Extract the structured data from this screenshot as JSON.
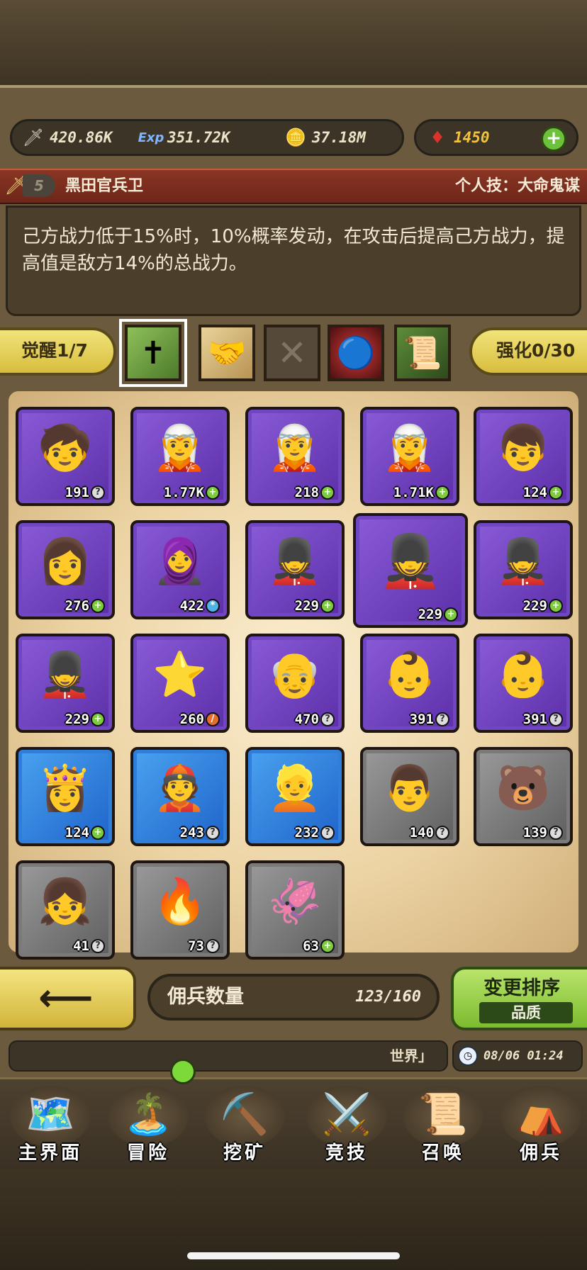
{
  "resources": {
    "attack": {
      "icon": "sword-icon",
      "value": "420.86K"
    },
    "exp": {
      "icon": "exp-icon",
      "value": "351.72K"
    },
    "gold": {
      "icon": "gold-coin-icon",
      "value": "37.18M"
    },
    "gems": {
      "icon": "ruby-icon",
      "value": "1450"
    }
  },
  "skill": {
    "level": "5",
    "name": "黑田官兵卫",
    "type_label": "个人技：大命鬼谋",
    "description": "己方战力低于15%时，10%概率发动，在攻击后提高己方战力，提高值是敌方14%的总战力。"
  },
  "tabs": {
    "awaken_label": "觉醒1/7",
    "enhance_label": "强化0/30",
    "equipment": [
      {
        "icon": "cross-totem-icon",
        "selected": true
      },
      {
        "icon": "handshake-arm-icon",
        "selected": false
      },
      {
        "icon": "empty-slot-x-icon",
        "selected": false
      },
      {
        "icon": "dark-orb-icon",
        "selected": false
      },
      {
        "icon": "scroll-bundle-icon",
        "selected": false
      }
    ]
  },
  "mercenaries": [
    {
      "sprite": "🧒",
      "rarity": "purple",
      "value": "191",
      "badge": "?"
    },
    {
      "sprite": "🧝",
      "rarity": "purple",
      "value": "1.77K",
      "badge": "+"
    },
    {
      "sprite": "🧝",
      "rarity": "purple",
      "value": "218",
      "badge": "+"
    },
    {
      "sprite": "🧝",
      "rarity": "purple",
      "value": "1.71K",
      "badge": "+"
    },
    {
      "sprite": "👦",
      "rarity": "purple",
      "value": "124",
      "badge": "+"
    },
    {
      "sprite": "👩",
      "rarity": "purple",
      "value": "276",
      "badge": "+"
    },
    {
      "sprite": "🧕",
      "rarity": "purple",
      "value": "422",
      "badge": "*"
    },
    {
      "sprite": "💂",
      "rarity": "purple",
      "value": "229",
      "badge": "+"
    },
    {
      "sprite": "💂",
      "rarity": "purple",
      "value": "229",
      "badge": "+",
      "selected": true
    },
    {
      "sprite": "💂",
      "rarity": "purple",
      "value": "229",
      "badge": "+"
    },
    {
      "sprite": "💂",
      "rarity": "purple",
      "value": "229",
      "badge": "+"
    },
    {
      "sprite": "⭐",
      "rarity": "purple",
      "value": "260",
      "badge": "/"
    },
    {
      "sprite": "👴",
      "rarity": "purple",
      "value": "470",
      "badge": "?"
    },
    {
      "sprite": "👶",
      "rarity": "purple",
      "value": "391",
      "badge": "?"
    },
    {
      "sprite": "👶",
      "rarity": "purple",
      "value": "391",
      "badge": "?"
    },
    {
      "sprite": "👸",
      "rarity": "blue",
      "value": "124",
      "badge": "+"
    },
    {
      "sprite": "👲",
      "rarity": "blue",
      "value": "243",
      "badge": "?"
    },
    {
      "sprite": "👱",
      "rarity": "blue",
      "value": "232",
      "badge": "?"
    },
    {
      "sprite": "👨",
      "rarity": "gray",
      "value": "140",
      "badge": "?"
    },
    {
      "sprite": "🐻",
      "rarity": "gray",
      "value": "139",
      "badge": "?"
    },
    {
      "sprite": "👧",
      "rarity": "gray",
      "value": "41",
      "badge": "?"
    },
    {
      "sprite": "🔥",
      "rarity": "gray",
      "value": "73",
      "badge": "?"
    },
    {
      "sprite": "🦑",
      "rarity": "gray",
      "value": "63",
      "badge": "+"
    }
  ],
  "footer": {
    "back_icon": "left-arrow-icon",
    "count_label": "佣兵数量",
    "count_value": "123/160",
    "sort_label": "变更排序",
    "sort_mode": "品质"
  },
  "chat": {
    "text": "世界」",
    "time": "08/06 01:24"
  },
  "nav": [
    {
      "icon": "🗺️",
      "label": "主界面"
    },
    {
      "icon": "🏝️",
      "label": "冒险"
    },
    {
      "icon": "⛏️",
      "label": "挖矿"
    },
    {
      "icon": "⚔️",
      "label": "竞技"
    },
    {
      "icon": "📜",
      "label": "召唤"
    },
    {
      "icon": "⛺",
      "label": "佣兵"
    }
  ]
}
